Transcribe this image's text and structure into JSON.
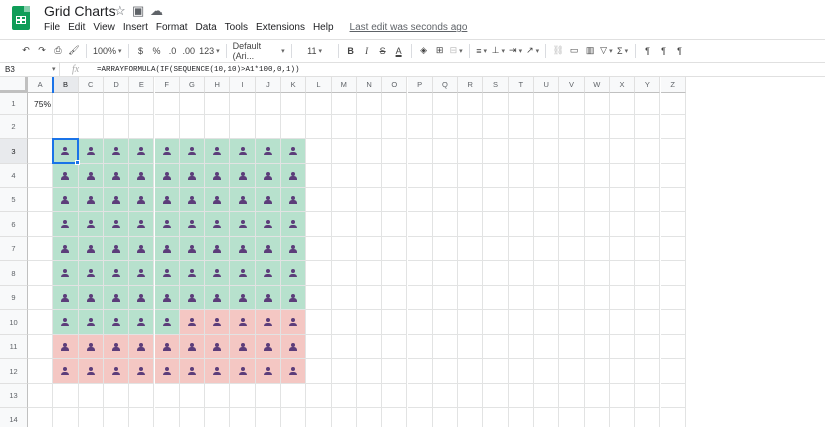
{
  "app": {
    "doc_title": "Grid Charts",
    "menus": [
      "File",
      "Edit",
      "View",
      "Insert",
      "Format",
      "Data",
      "Tools",
      "Extensions",
      "Help"
    ],
    "last_edit": "Last edit was seconds ago"
  },
  "toolbar": {
    "zoom": "100%",
    "currency": "$",
    "percent": "%",
    "decrease_decimal": ".0",
    "increase_decimal": ".00",
    "more_formats": "123",
    "font_family": "Default (Ari...",
    "font_size": "11",
    "bold": "B",
    "italic": "I",
    "strike": "S",
    "text_color": "A"
  },
  "formula_bar": {
    "name_box": "B3",
    "fx": "fx",
    "formula": "=ARRAYFORMULA(IF(SEQUENCE(10,10)>A1*100,0,1))"
  },
  "sheet": {
    "columns": [
      "A",
      "B",
      "C",
      "D",
      "E",
      "F",
      "G",
      "H",
      "I",
      "J",
      "K",
      "L",
      "M",
      "N",
      "O",
      "P",
      "Q",
      "R",
      "S",
      "T",
      "U",
      "V",
      "W",
      "X",
      "Y",
      "Z"
    ],
    "rows": [
      "1",
      "2",
      "3",
      "4",
      "5",
      "6",
      "7",
      "8",
      "9",
      "10",
      "11",
      "12",
      "13",
      "14"
    ],
    "a1_value": "75%",
    "selected_cell": "B3",
    "grid_chart": {
      "fill_percent": 75,
      "cell_count": 100,
      "filled_color": "#b7e1cd",
      "empty_color": "#f4c7c3",
      "icon": "person-icon",
      "icon_color": "#5c3d7a"
    }
  }
}
